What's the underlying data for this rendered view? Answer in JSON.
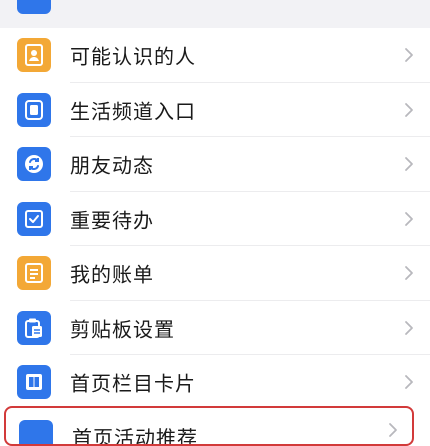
{
  "list": {
    "items": [
      {
        "label": "可能认识的人",
        "icon": "contacts-icon",
        "color": "#f3a836"
      },
      {
        "label": "生活频道入口",
        "icon": "channel-icon",
        "color": "#2f76ea"
      },
      {
        "label": "朋友动态",
        "icon": "refresh-circle-icon",
        "color": "#2f76ea"
      },
      {
        "label": "重要待办",
        "icon": "todo-check-icon",
        "color": "#2f76ea"
      },
      {
        "label": "我的账单",
        "icon": "bill-icon",
        "color": "#f3a836"
      },
      {
        "label": "剪贴板设置",
        "icon": "clipboard-icon",
        "color": "#2f76ea"
      },
      {
        "label": "首页栏目卡片",
        "icon": "card-layout-icon",
        "color": "#2f76ea"
      }
    ],
    "partial_bottom": {
      "label": "首页活动推荐",
      "icon": "app-icon",
      "color": "#2f76ea"
    }
  },
  "colors": {
    "highlight_border": "#d23a3a",
    "chevron": "#b8b8bd"
  }
}
